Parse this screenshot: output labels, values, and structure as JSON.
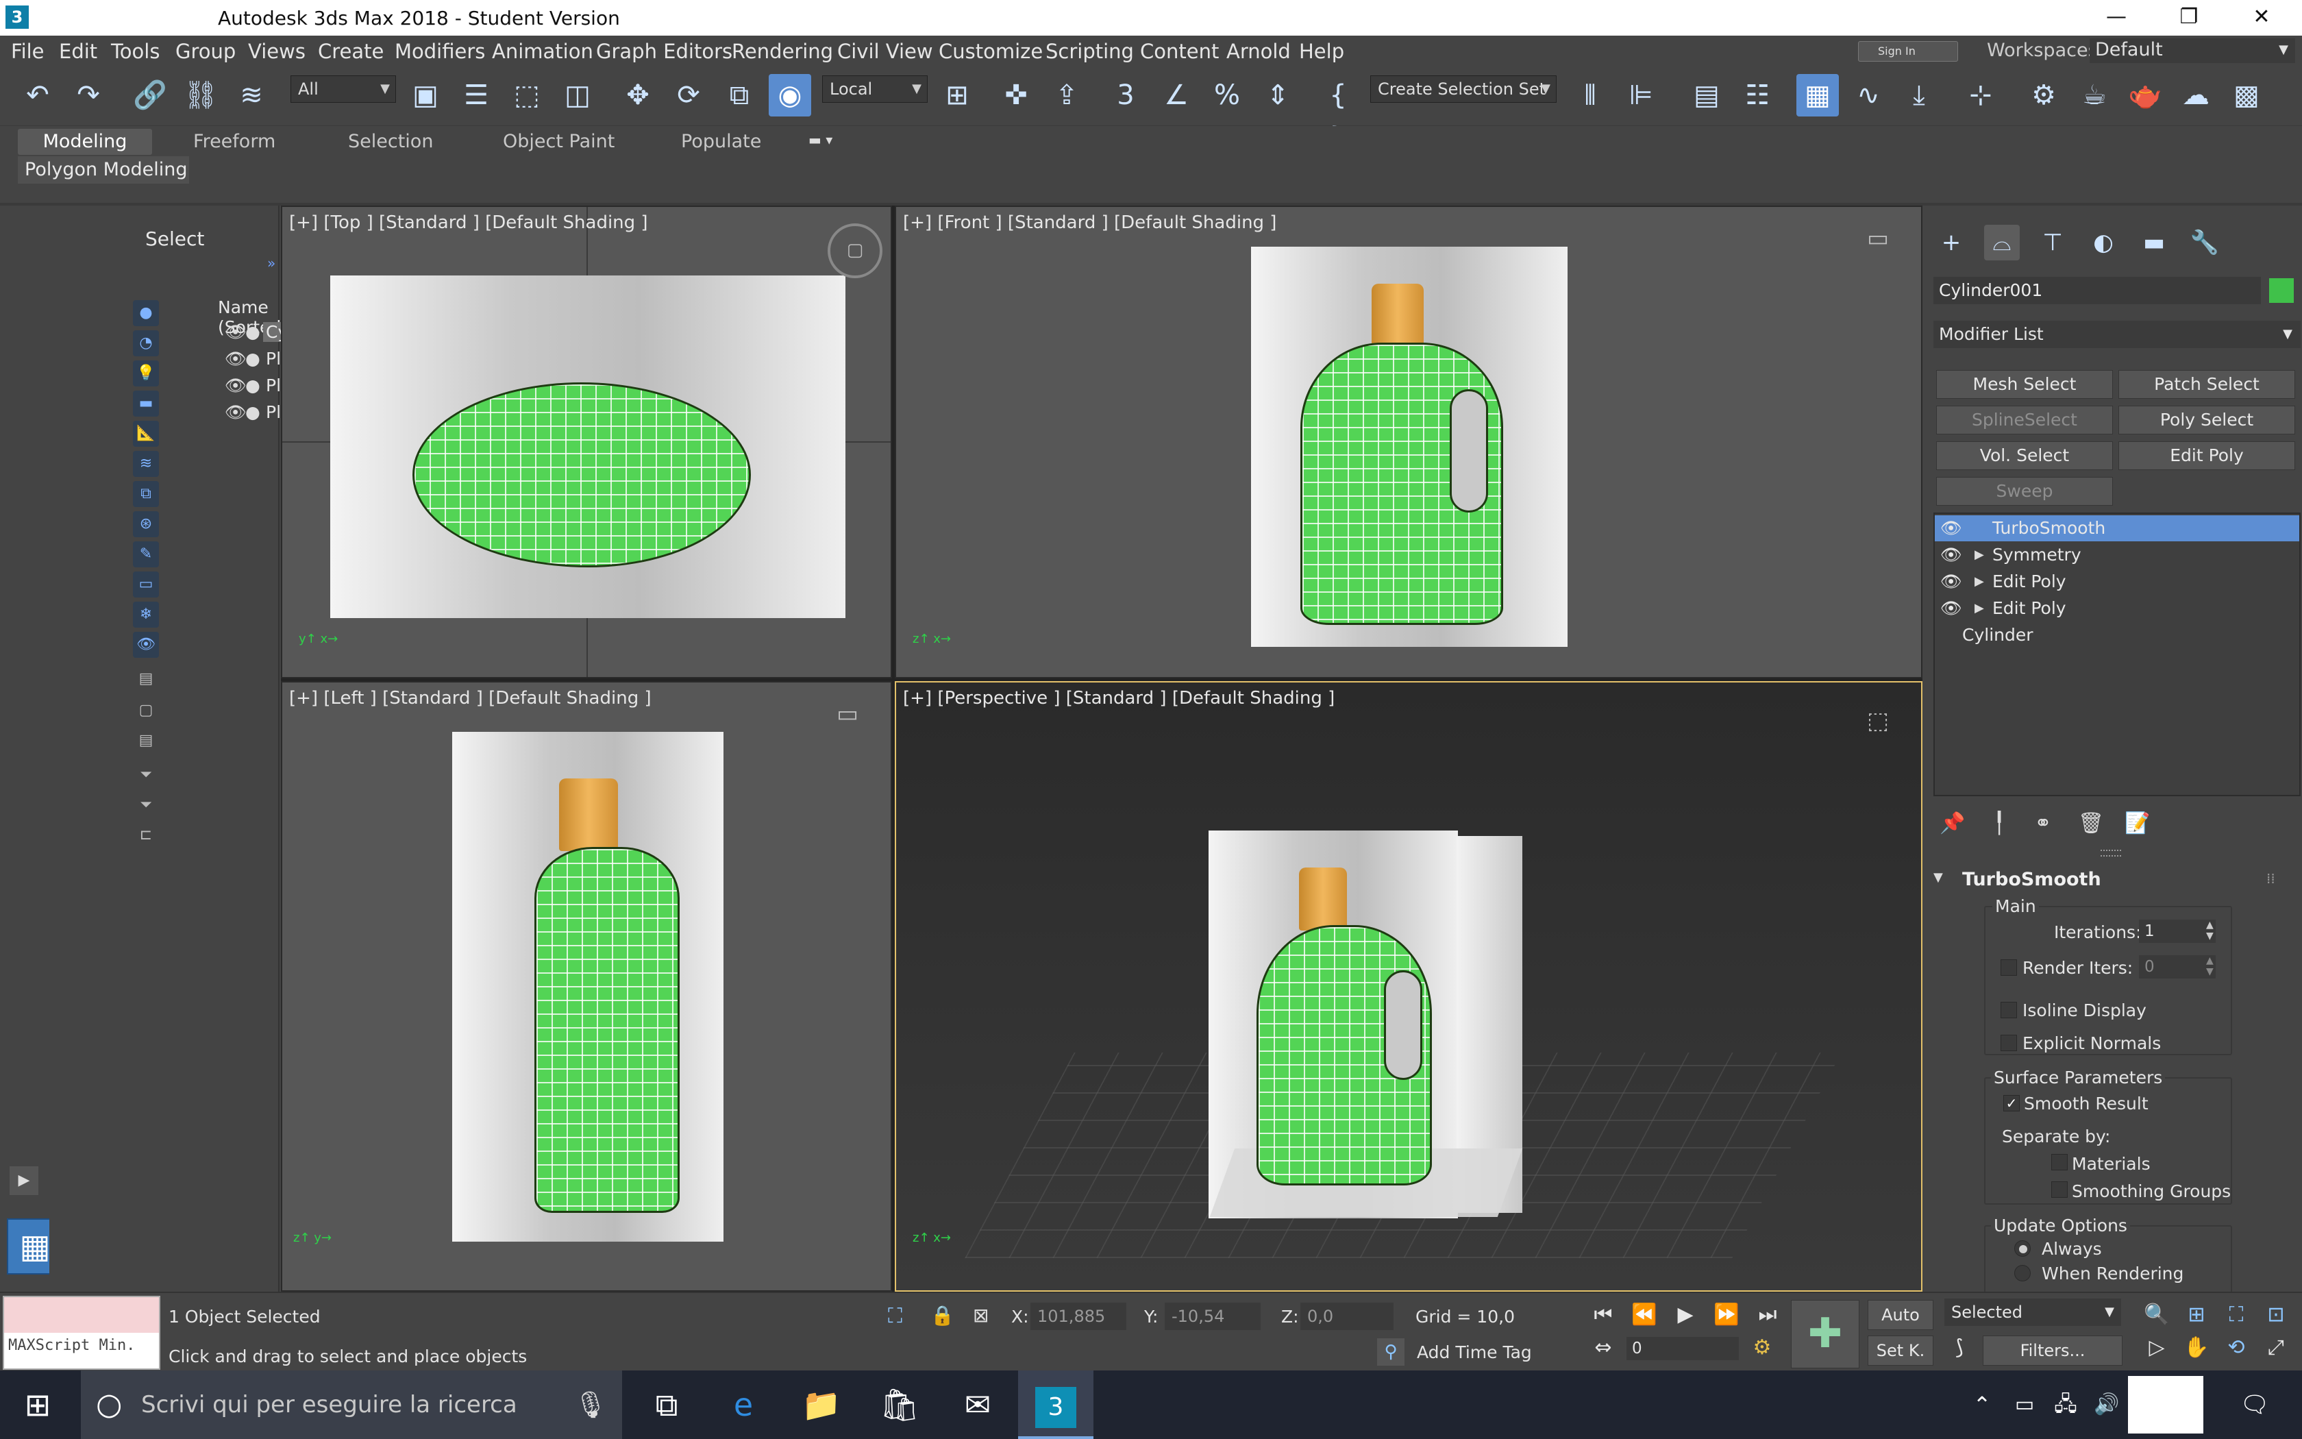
{
  "window": {
    "title": "Autodesk 3ds Max 2018 - Student Version",
    "app_icon": "3",
    "minimize": "—",
    "restore": "❐",
    "close": "✕"
  },
  "menu": [
    "File",
    "Edit",
    "Tools",
    "Group",
    "Views",
    "Create",
    "Modifiers",
    "Animation",
    "Graph Editors",
    "Rendering",
    "Civil View",
    "Customize",
    "Scripting",
    "Content",
    "Arnold",
    "Help"
  ],
  "account": {
    "signin": "Sign In",
    "workspaces_label": "Workspaces:",
    "workspace": "Default"
  },
  "toolbar": {
    "filter": "All",
    "coord_system": "Local",
    "selection_set": "Create Selection Set"
  },
  "ribbon": {
    "tabs": [
      "Modeling",
      "Freeform",
      "Selection",
      "Object Paint",
      "Populate"
    ],
    "active_tab": "Modeling",
    "panel": "Polygon Modeling"
  },
  "scene_explorer": {
    "title": "Select",
    "column": "Name (Sorted",
    "rows": [
      "Cylind",
      "Plane",
      "Plane",
      "Plane"
    ]
  },
  "viewports": {
    "top": "[+] [Top ] [Standard ] [Default Shading ]",
    "front": "[+] [Front ] [Standard ] [Default Shading ]",
    "left": "[+] [Left ] [Standard ] [Default Shading ]",
    "perspective": "[+] [Perspective ] [Standard ] [Default Shading ]"
  },
  "command_panel": {
    "object_name": "Cylinder001",
    "object_color": "#40c14a",
    "modifier_list": "Modifier List",
    "buttons": [
      {
        "label": "Mesh Select",
        "enabled": true
      },
      {
        "label": "Patch Select",
        "enabled": true
      },
      {
        "label": "SplineSelect",
        "enabled": false
      },
      {
        "label": "Poly Select",
        "enabled": true
      },
      {
        "label": "Vol. Select",
        "enabled": true
      },
      {
        "label": "Edit Poly",
        "enabled": true
      },
      {
        "label": "Sweep",
        "enabled": false
      }
    ],
    "stack": [
      "TurboSmooth",
      "Symmetry",
      "Edit Poly",
      "Edit Poly",
      "Cylinder"
    ],
    "turbosmooth": {
      "title": "TurboSmooth",
      "main": "Main",
      "iterations_label": "Iterations:",
      "iterations": "1",
      "render_iters_label": "Render Iters:",
      "render_iters": "0",
      "isoline": "Isoline Display",
      "explicit_normals": "Explicit Normals",
      "surface_params": "Surface Parameters",
      "smooth_result": "Smooth Result",
      "separate_by": "Separate by:",
      "materials": "Materials",
      "smoothing_groups": "Smoothing Groups",
      "update_options": "Update Options",
      "always": "Always",
      "when_rendering": "When Rendering"
    }
  },
  "status": {
    "selected": "1 Object Selected",
    "prompt": "Click and drag to select and place objects",
    "maxscript": "MAXScript Min.",
    "x_label": "X:",
    "x": "101,885",
    "y_label": "Y:",
    "y": "-10,54",
    "z_label": "Z:",
    "z": "0,0",
    "grid": "Grid = 10,0",
    "add_time_tag": "Add Time Tag",
    "auto": "Auto",
    "setkey": "Set K.",
    "key_filter": "Selected",
    "filters": "Filters...",
    "frame": "0"
  },
  "taskbar": {
    "search_placeholder": "Scrivi qui per eseguire la ricerca"
  }
}
